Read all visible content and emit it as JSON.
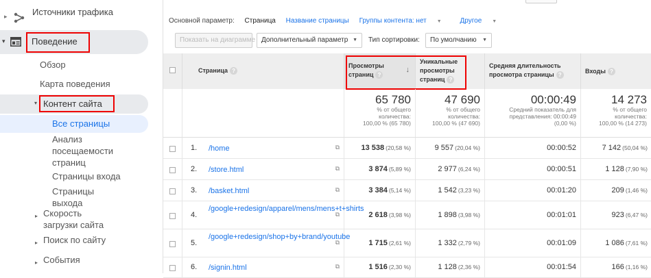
{
  "sidebar": {
    "traffic_sources": "Источники трафика",
    "behavior": "Поведение",
    "overview": "Обзор",
    "behavior_flow": "Карта поведения",
    "site_content": "Контент сайта",
    "all_pages": "Все страницы",
    "content_drilldown": "Анализ посещаемости страниц",
    "landing_pages": "Страницы входа",
    "exit_pages": "Страницы выхода",
    "site_speed": "Скорость загрузки сайта",
    "site_search": "Поиск по сайту",
    "events": "События"
  },
  "dimension_bar": {
    "label": "Основной параметр:",
    "current": "Страница",
    "page_title": "Название страницы",
    "content_group": "Группы контента: нет",
    "other": "Другое"
  },
  "toolbar": {
    "plot_rows": "Показать на диаграмме",
    "secondary_dimension": "Дополнительный параметр",
    "sort_type_label": "Тип сортировки:",
    "sort_type_value": "По умолчанию"
  },
  "columns": {
    "page": "Страница",
    "pageviews": "Просмотры страниц",
    "unique_pageviews": "Уникальные просмотры страниц",
    "avg_time": "Средняя длительность просмотра страницы",
    "entrances": "Входы"
  },
  "totals": {
    "pageviews": "65 780",
    "pageviews_note": "% от общего количества: 100,00 % (65 780)",
    "unique": "47 690",
    "unique_note": "% от общего количества: 100,00 % (47 690)",
    "avg_time": "00:00:49",
    "avg_time_note": "Средний показатель для представления: 00:00:49 (0,00 %)",
    "entrances": "14 273",
    "entrances_note": "% от общего количества: 100,00 % (14 273)"
  },
  "rows": [
    {
      "n": "1.",
      "page": "/home",
      "pv": "13 538",
      "pv_pct": "(20,58 %)",
      "u": "9 557",
      "u_pct": "(20,04 %)",
      "t": "00:00:52",
      "e": "7 142",
      "e_pct": "(50,04 %)"
    },
    {
      "n": "2.",
      "page": "/store.html",
      "pv": "3 874",
      "pv_pct": "(5,89 %)",
      "u": "2 977",
      "u_pct": "(6,24 %)",
      "t": "00:00:51",
      "e": "1 128",
      "e_pct": "(7,90 %)"
    },
    {
      "n": "3.",
      "page": "/basket.html",
      "pv": "3 384",
      "pv_pct": "(5,14 %)",
      "u": "1 542",
      "u_pct": "(3,23 %)",
      "t": "00:01:20",
      "e": "209",
      "e_pct": "(1,46 %)"
    },
    {
      "n": "4.",
      "page": "/google+redesign/apparel/mens/mens+t+shirts",
      "pv": "2 618",
      "pv_pct": "(3,98 %)",
      "u": "1 898",
      "u_pct": "(3,98 %)",
      "t": "00:01:01",
      "e": "923",
      "e_pct": "(6,47 %)"
    },
    {
      "n": "5.",
      "page": "/google+redesign/shop+by+brand/youtube",
      "pv": "1 715",
      "pv_pct": "(2,61 %)",
      "u": "1 332",
      "u_pct": "(2,79 %)",
      "t": "00:01:09",
      "e": "1 086",
      "e_pct": "(7,61 %)"
    },
    {
      "n": "6.",
      "page": "/signin.html",
      "pv": "1 516",
      "pv_pct": "(2,30 %)",
      "u": "1 128",
      "u_pct": "(2,36 %)",
      "t": "00:01:54",
      "e": "166",
      "e_pct": "(1,16 %)"
    }
  ]
}
